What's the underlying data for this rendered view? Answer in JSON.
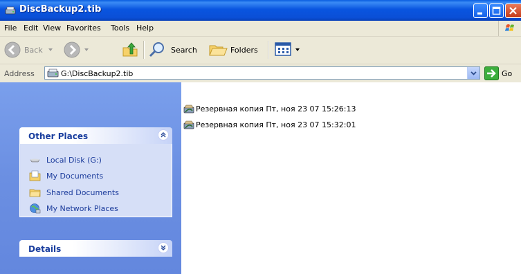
{
  "window": {
    "title": "DiscBackup2.tib"
  },
  "menu": [
    "File",
    "Edit",
    "View",
    "Favorites",
    "Tools",
    "Help"
  ],
  "toolbar": {
    "back_label": "Back",
    "search_label": "Search",
    "folders_label": "Folders"
  },
  "address": {
    "label": "Address",
    "value": "G:\\DiscBackup2.tib",
    "go_label": "Go"
  },
  "other_places": {
    "title": "Other Places",
    "items": [
      {
        "label": "Local Disk (G:)",
        "icon": "drive-icon"
      },
      {
        "label": "My Documents",
        "icon": "my-documents-icon"
      },
      {
        "label": "Shared Documents",
        "icon": "folder-icon"
      },
      {
        "label": "My Network Places",
        "icon": "network-icon"
      }
    ]
  },
  "details": {
    "title": "Details"
  },
  "files": [
    {
      "name": "Резервная копия Пт, ноя 23 07 15:26:13",
      "icon": "backup-icon"
    },
    {
      "name": "Резервная копия Пт, ноя 23 07 15:32:01",
      "icon": "backup-icon"
    }
  ],
  "colors": {
    "titlebar": "#0a4fd6",
    "chrome": "#ece9d8",
    "taskpane": "#6b8fe2",
    "link": "#1c3c9c"
  }
}
